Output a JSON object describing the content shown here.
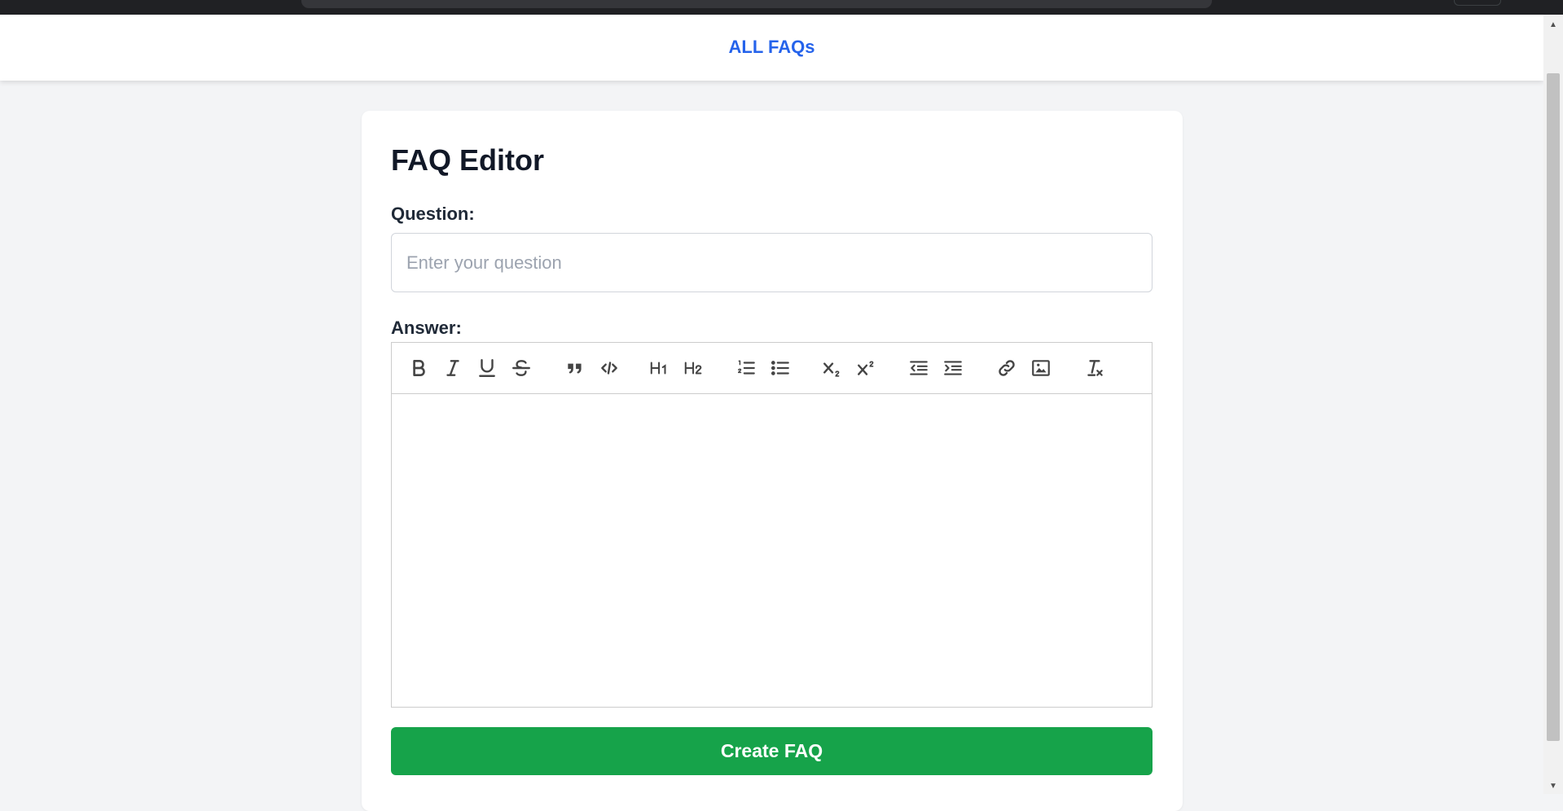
{
  "nav": {
    "link_label": "ALL FAQs"
  },
  "editor": {
    "title": "FAQ Editor",
    "question_label": "Question:",
    "question_placeholder": "Enter your question",
    "question_value": "",
    "answer_label": "Answer:",
    "answer_value": "",
    "toolbar_icons": [
      "bold-icon",
      "italic-icon",
      "underline-icon",
      "strikethrough-icon",
      "blockquote-icon",
      "code-block-icon",
      "heading-1-icon",
      "heading-2-icon",
      "ordered-list-icon",
      "bullet-list-icon",
      "subscript-icon",
      "superscript-icon",
      "outdent-icon",
      "indent-icon",
      "link-icon",
      "image-icon",
      "clear-format-icon"
    ],
    "submit_label": "Create FAQ"
  },
  "colors": {
    "accent_link": "#2563eb",
    "submit": "#16a34a",
    "page_background": "#f3f4f6"
  }
}
